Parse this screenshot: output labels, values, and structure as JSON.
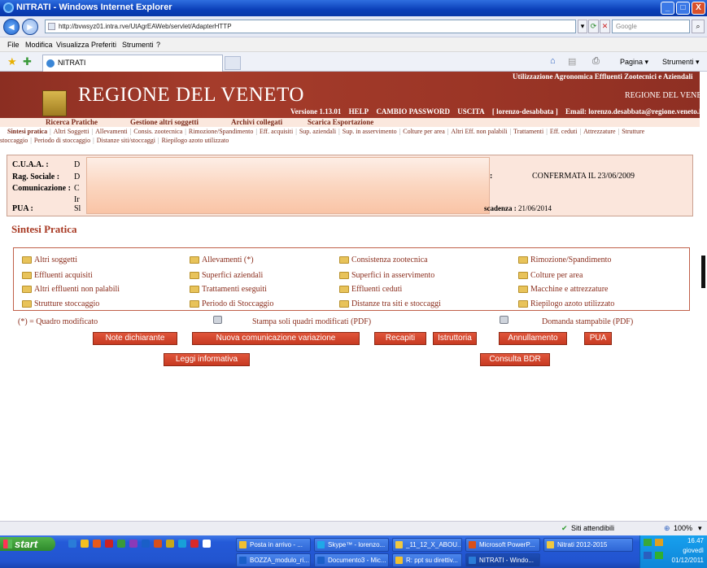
{
  "window": {
    "title": "NITRATI - Windows Internet Explorer",
    "controls": [
      "_",
      "□",
      "X"
    ]
  },
  "address": {
    "url": "http://bvwsyz01.intra.rve/UtAgrEAWeb/servlet/AdapterHTTP",
    "search_placeholder": "Google"
  },
  "menu": [
    "File",
    "Modifica",
    "Visualizza",
    "Preferiti",
    "Strumenti",
    "?"
  ],
  "tab": {
    "title": "NITRATI",
    "toolbar": [
      "Pagina ▾",
      "Strumenti ▾"
    ]
  },
  "header": {
    "brand": "REGIONE DEL VENETO",
    "subtitle": "Utilizzazione Agronomica Effluenti Zootecnici e Aziendali",
    "region": "REGIONE DEL VENETO",
    "version": "Versione 1.13.01",
    "help": "HELP",
    "change_pw": "CAMBIO PASSWORD",
    "exit": "USCITA",
    "user": "[ lorenzo-desabbata ]",
    "email": "Email: lorenzo.desabbata@regione.veneto.it"
  },
  "topnav": [
    "Ricerca Pratiche",
    "Gestione altri soggetti",
    "Archivi collegati",
    "Scarica Esportazione"
  ],
  "subnav": {
    "line1": [
      "Sintesi pratica",
      "Altri Soggetti",
      "Allevamenti",
      "Consis. zootecnica",
      "Rimozione/Spandimento",
      "Eff. acquisiti",
      "Sup. aziendali",
      "Sup. in asservimento",
      "Colture per area",
      "Altri Eff. non palabili",
      "Trattamenti",
      "Eff. ceduti",
      "Attrezzature",
      "Strutture"
    ],
    "line2": [
      "stoccaggio",
      "Periodo di stoccaggio",
      "Distanze siti/stoccaggi",
      "Riepilogo azoto utilizzato"
    ]
  },
  "info": {
    "cuaa_label": "C.U.A.A. :",
    "cuaa_value": "D",
    "rag_label": "Rag. Sociale :",
    "rag_value": "D",
    "com_label": "Comunicazione :",
    "com_value": "C",
    "extra_value": "Ir",
    "pua_label": "PUA :",
    "pua_value": "Sl",
    "colon": ":",
    "state": "CONFERMATA IL 23/06/2009",
    "scad_label": "scadenza :",
    "scad_value": "21/06/2014"
  },
  "section_title": "Sintesi Pratica",
  "links": {
    "col1": [
      "Altri soggetti",
      "Effluenti acquisiti",
      "Altri effluenti non palabili",
      "Strutture stoccaggio"
    ],
    "col2": [
      "Allevamenti (*)",
      "Superfici aziendali",
      "Trattamenti eseguiti",
      "Periodo di Stoccaggio"
    ],
    "col3": [
      "Consistenza zootecnica",
      "Superfici in asservimento",
      "Effluenti ceduti",
      "Distanze tra siti e stoccaggi"
    ],
    "col4": [
      "Rimozione/Spandimento",
      "Colture per area",
      "Macchine e attrezzature",
      "Riepilogo azoto utilizzato"
    ]
  },
  "legend": "(*) = Quadro modificato",
  "print1": "Stampa soli quadri modificati (PDF)",
  "print2": "Domanda stampabile (PDF)",
  "buttons": {
    "note": "Note dichiarante",
    "nuova": "Nuova comunicazione variazione",
    "recapiti": "Recapiti",
    "istruttoria": "Istruttoria",
    "annullamento": "Annullamento",
    "pua": "PUA",
    "leggi": "Leggi informativa",
    "consulta": "Consulta BDR"
  },
  "statusbar": {
    "zone": "Siti attendibili",
    "zoom": "100%"
  },
  "taskbar": {
    "start": "start",
    "row1": [
      "Posta in arrivo - ...",
      "Skype™ - lorenzo...",
      "_11_12_X_ABOU...",
      "Microsoft PowerP...",
      "Nitrati 2012-2015"
    ],
    "row2": [
      "BOZZA_modulo_ri...",
      "Documento3 - Mic...",
      "R: ppt su direttiv...",
      "NITRATI - Windo..."
    ],
    "time": "16.47",
    "day": "giovedì",
    "date": "01/12/2011"
  },
  "colors": {
    "header_bg": "#9b3526",
    "accent": "#8a2d1c",
    "button": "#c73a22",
    "info_bg": "#fbe6dc"
  }
}
